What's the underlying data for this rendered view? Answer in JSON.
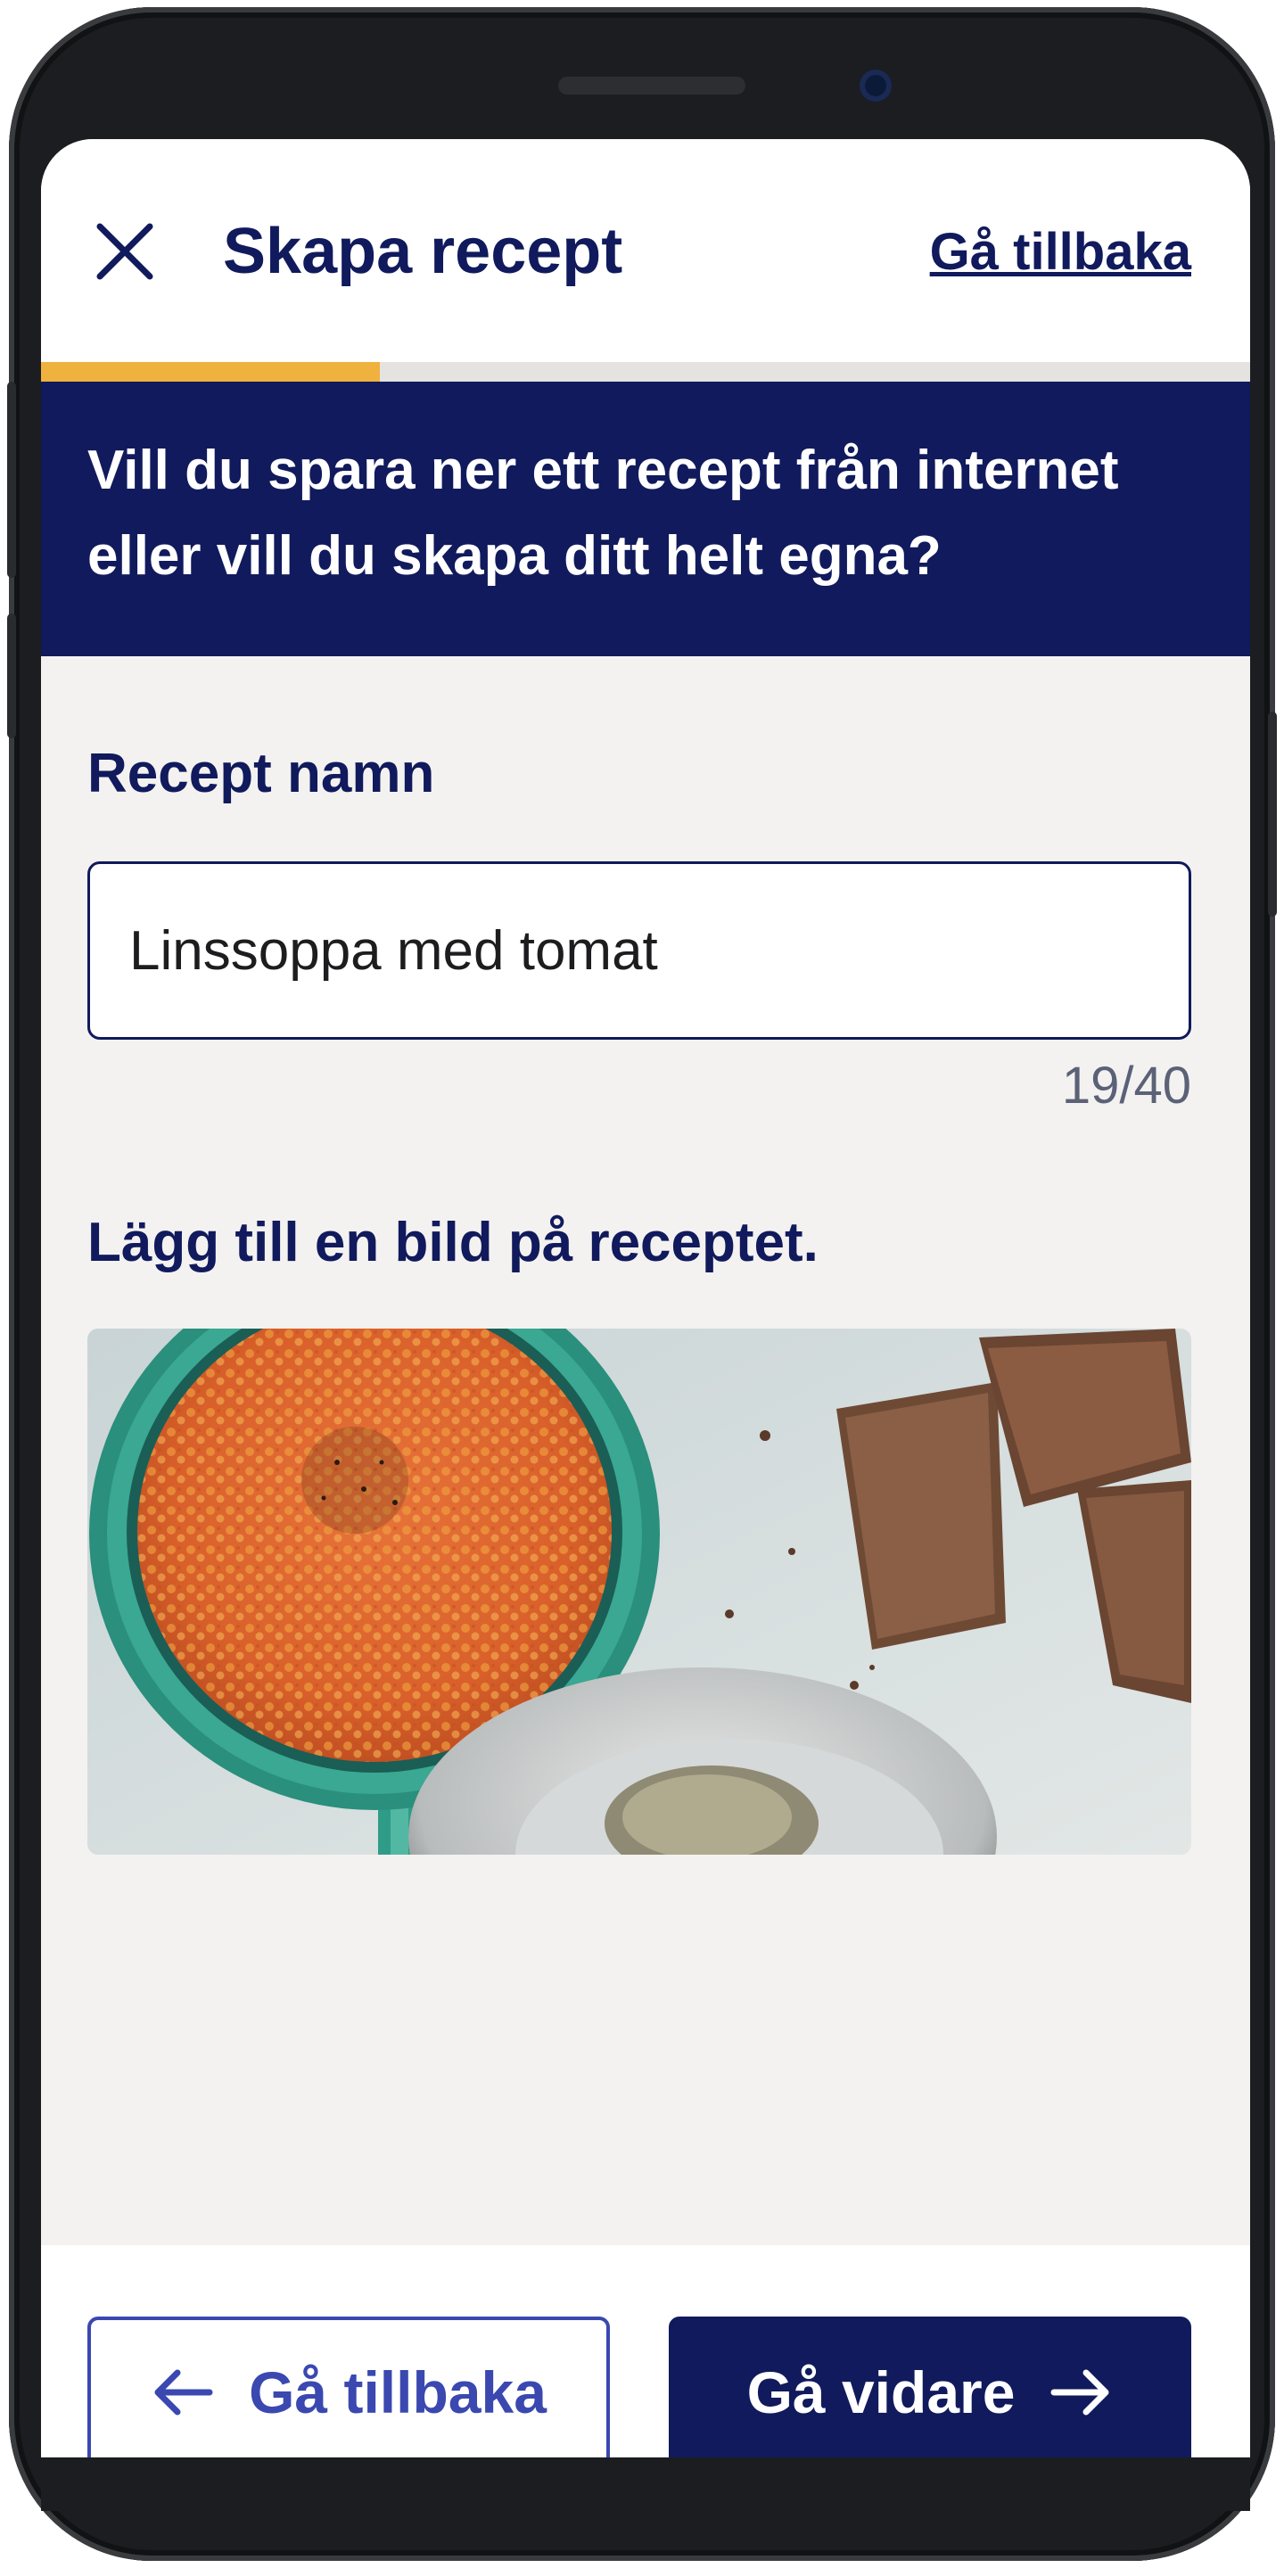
{
  "header": {
    "title": "Skapa recept",
    "back_link": "Gå tillbaka"
  },
  "progress": {
    "value_percent": 28,
    "fill_color": "#f0b23e"
  },
  "banner": {
    "line1": "Vill du spara ner ett recept från internet",
    "line2": "eller vill du skapa ditt helt egna?"
  },
  "recipe_name": {
    "label": "Recept namn",
    "value": "Linssoppa med tomat",
    "counter": "19/40"
  },
  "image_section": {
    "label": "Lägg till en bild på receptet."
  },
  "footer": {
    "back_button": "Gå tillbaka",
    "next_button": "Gå vidare"
  },
  "colors": {
    "primary": "#101a5c",
    "accent": "#f0b23e",
    "secondary_button": "#3a48b0",
    "background": "#f3f2f0"
  },
  "icons": [
    "close-icon",
    "arrow-left-icon",
    "arrow-right-icon"
  ]
}
